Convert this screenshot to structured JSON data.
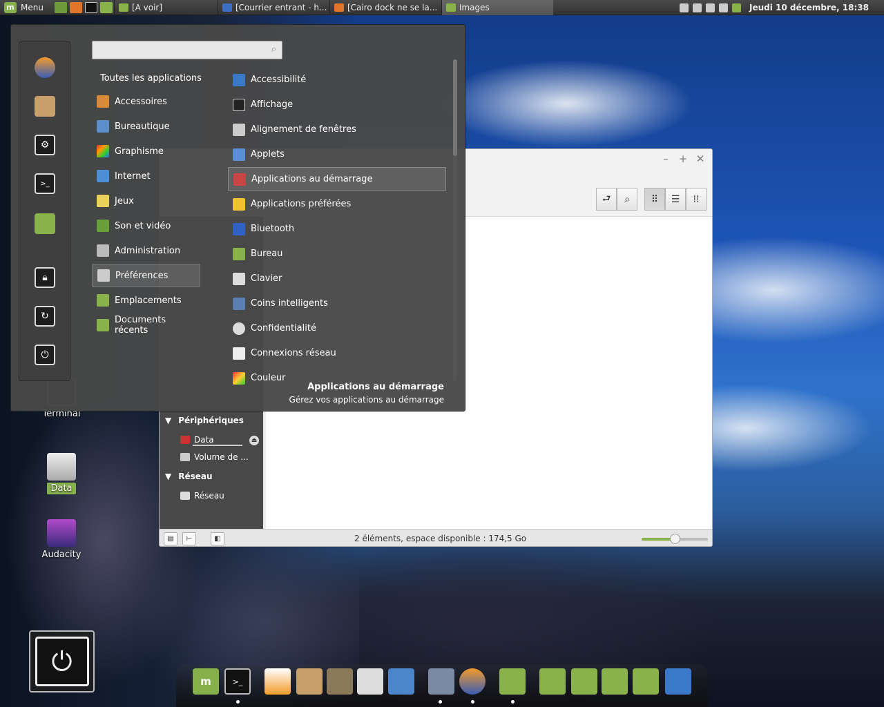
{
  "panel": {
    "menu_label": "Menu",
    "tasks": [
      {
        "label": "[A voir]"
      },
      {
        "label": "[Courrier entrant - h..."
      },
      {
        "label": "[Cairo dock ne se la..."
      },
      {
        "label": "Images"
      }
    ],
    "clock": "Jeudi 10 décembre, 18:38"
  },
  "menu": {
    "all_apps": "Toutes les applications",
    "categories": [
      {
        "label": "Accessoires"
      },
      {
        "label": "Bureautique"
      },
      {
        "label": "Graphisme"
      },
      {
        "label": "Internet"
      },
      {
        "label": "Jeux"
      },
      {
        "label": "Son et vidéo"
      },
      {
        "label": "Administration"
      },
      {
        "label": "Préférences"
      },
      {
        "label": "Emplacements"
      },
      {
        "label": "Documents récents"
      }
    ],
    "apps": [
      {
        "label": "Accessibilité"
      },
      {
        "label": "Affichage"
      },
      {
        "label": "Alignement de fenêtres"
      },
      {
        "label": "Applets"
      },
      {
        "label": "Applications au démarrage"
      },
      {
        "label": "Applications préférées"
      },
      {
        "label": "Bluetooth"
      },
      {
        "label": "Bureau"
      },
      {
        "label": "Clavier"
      },
      {
        "label": "Coins intelligents"
      },
      {
        "label": "Confidentialité"
      },
      {
        "label": "Connexions réseau"
      },
      {
        "label": "Couleur"
      }
    ],
    "selected_category": "Préférences",
    "selected_app": "Applications au démarrage",
    "description_title": "Applications au démarrage",
    "description_text": "Gérez vos applications au démarrage"
  },
  "file_manager": {
    "sidebar": {
      "devices_header": "Périphériques",
      "devices": [
        {
          "label": "Data"
        },
        {
          "label": "Volume de ..."
        }
      ],
      "network_header": "Réseau",
      "network": [
        {
          "label": "Réseau"
        }
      ]
    },
    "status": "2 éléments, espace disponible : 174,5 Go",
    "zoom_level": 0.5
  },
  "desktop": {
    "icons": [
      {
        "label": "Terminal"
      },
      {
        "label": "Data"
      },
      {
        "label": "Audacity"
      }
    ]
  },
  "colors": {
    "accent": "#86b04b",
    "menu_bg": "#484848"
  }
}
